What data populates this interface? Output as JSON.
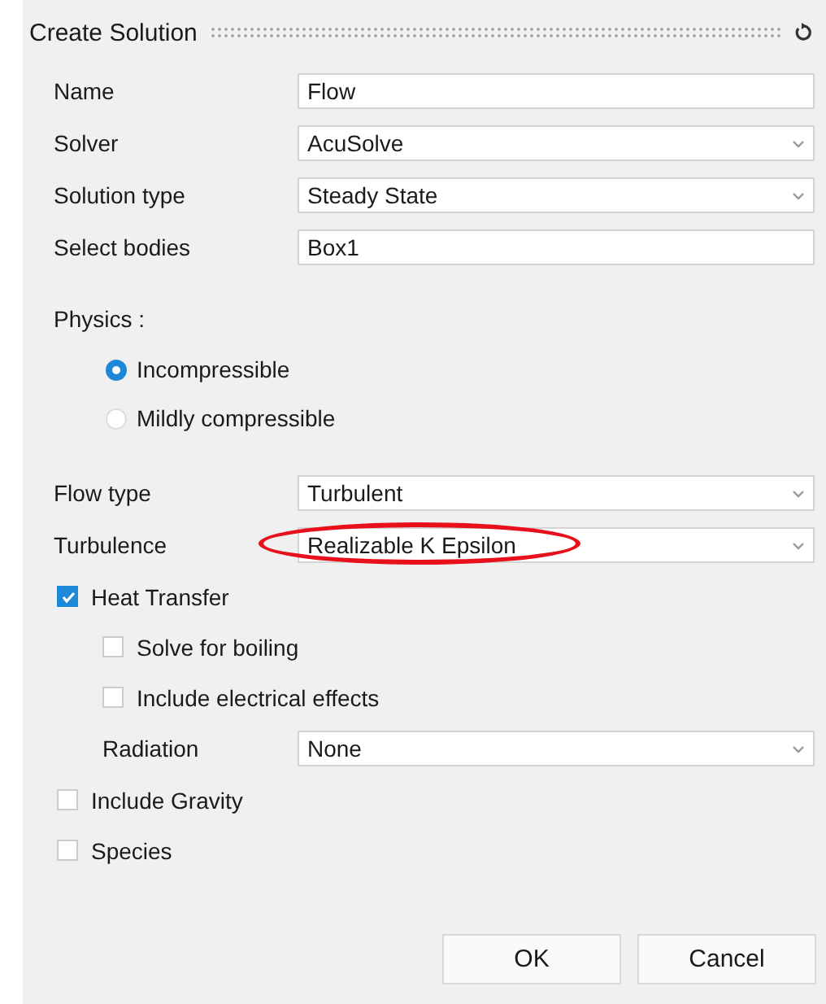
{
  "window": {
    "title": "Create Solution"
  },
  "fields": [
    {
      "kind": "text",
      "label": "Name",
      "value": "Flow"
    },
    {
      "kind": "dropdown",
      "label": "Solver",
      "value": "AcuSolve"
    },
    {
      "kind": "dropdown",
      "label": "Solution type",
      "value": "Steady State"
    },
    {
      "kind": "text",
      "label": "Select bodies",
      "value": "Box1"
    }
  ],
  "physics": {
    "label": "Physics :",
    "options": [
      {
        "label": "Incompressible",
        "selected": true
      },
      {
        "label": "Mildly compressible",
        "selected": false
      }
    ]
  },
  "flow_fields": [
    {
      "kind": "dropdown",
      "label": "Flow type",
      "value": "Turbulent"
    },
    {
      "kind": "dropdown",
      "label": "Turbulence",
      "value": "Realizable K Epsilon",
      "highlighted": true
    }
  ],
  "options": [
    {
      "kind": "checkbox",
      "label": "Heat Transfer",
      "checked": true,
      "children": [
        {
          "kind": "checkbox",
          "label": "Solve for boiling",
          "checked": false
        },
        {
          "kind": "checkbox",
          "label": "Include electrical effects",
          "checked": false
        },
        {
          "kind": "dropdown",
          "label": "Radiation",
          "value": "None"
        }
      ]
    },
    {
      "kind": "checkbox",
      "label": "Include Gravity",
      "checked": false
    },
    {
      "kind": "checkbox",
      "label": "Species",
      "checked": false
    }
  ],
  "buttons": [
    "OK",
    "Cancel"
  ]
}
